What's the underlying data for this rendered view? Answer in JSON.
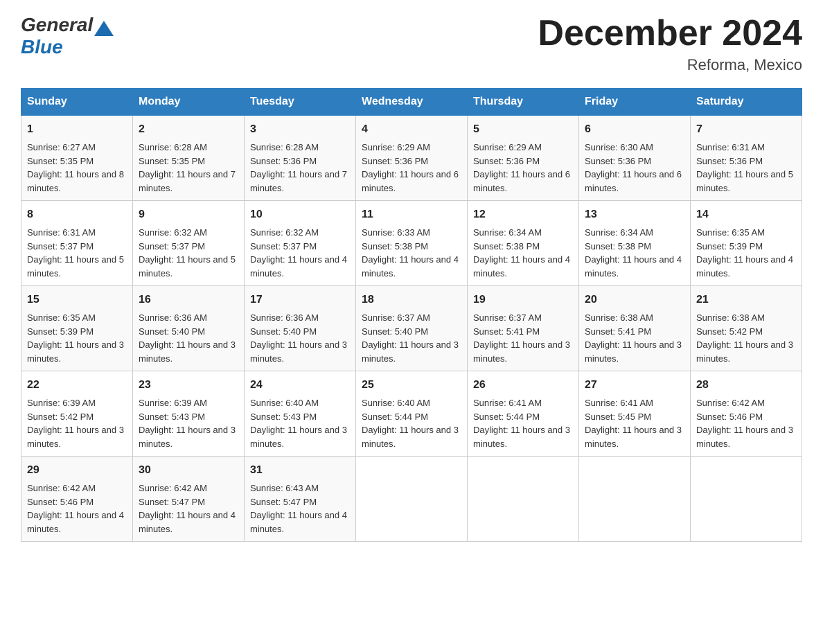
{
  "header": {
    "logo_general": "General",
    "logo_blue": "Blue",
    "month_title": "December 2024",
    "location": "Reforma, Mexico"
  },
  "days_of_week": [
    "Sunday",
    "Monday",
    "Tuesday",
    "Wednesday",
    "Thursday",
    "Friday",
    "Saturday"
  ],
  "weeks": [
    [
      {
        "day": "1",
        "sunrise": "6:27 AM",
        "sunset": "5:35 PM",
        "daylight": "11 hours and 8 minutes."
      },
      {
        "day": "2",
        "sunrise": "6:28 AM",
        "sunset": "5:35 PM",
        "daylight": "11 hours and 7 minutes."
      },
      {
        "day": "3",
        "sunrise": "6:28 AM",
        "sunset": "5:36 PM",
        "daylight": "11 hours and 7 minutes."
      },
      {
        "day": "4",
        "sunrise": "6:29 AM",
        "sunset": "5:36 PM",
        "daylight": "11 hours and 6 minutes."
      },
      {
        "day": "5",
        "sunrise": "6:29 AM",
        "sunset": "5:36 PM",
        "daylight": "11 hours and 6 minutes."
      },
      {
        "day": "6",
        "sunrise": "6:30 AM",
        "sunset": "5:36 PM",
        "daylight": "11 hours and 6 minutes."
      },
      {
        "day": "7",
        "sunrise": "6:31 AM",
        "sunset": "5:36 PM",
        "daylight": "11 hours and 5 minutes."
      }
    ],
    [
      {
        "day": "8",
        "sunrise": "6:31 AM",
        "sunset": "5:37 PM",
        "daylight": "11 hours and 5 minutes."
      },
      {
        "day": "9",
        "sunrise": "6:32 AM",
        "sunset": "5:37 PM",
        "daylight": "11 hours and 5 minutes."
      },
      {
        "day": "10",
        "sunrise": "6:32 AM",
        "sunset": "5:37 PM",
        "daylight": "11 hours and 4 minutes."
      },
      {
        "day": "11",
        "sunrise": "6:33 AM",
        "sunset": "5:38 PM",
        "daylight": "11 hours and 4 minutes."
      },
      {
        "day": "12",
        "sunrise": "6:34 AM",
        "sunset": "5:38 PM",
        "daylight": "11 hours and 4 minutes."
      },
      {
        "day": "13",
        "sunrise": "6:34 AM",
        "sunset": "5:38 PM",
        "daylight": "11 hours and 4 minutes."
      },
      {
        "day": "14",
        "sunrise": "6:35 AM",
        "sunset": "5:39 PM",
        "daylight": "11 hours and 4 minutes."
      }
    ],
    [
      {
        "day": "15",
        "sunrise": "6:35 AM",
        "sunset": "5:39 PM",
        "daylight": "11 hours and 3 minutes."
      },
      {
        "day": "16",
        "sunrise": "6:36 AM",
        "sunset": "5:40 PM",
        "daylight": "11 hours and 3 minutes."
      },
      {
        "day": "17",
        "sunrise": "6:36 AM",
        "sunset": "5:40 PM",
        "daylight": "11 hours and 3 minutes."
      },
      {
        "day": "18",
        "sunrise": "6:37 AM",
        "sunset": "5:40 PM",
        "daylight": "11 hours and 3 minutes."
      },
      {
        "day": "19",
        "sunrise": "6:37 AM",
        "sunset": "5:41 PM",
        "daylight": "11 hours and 3 minutes."
      },
      {
        "day": "20",
        "sunrise": "6:38 AM",
        "sunset": "5:41 PM",
        "daylight": "11 hours and 3 minutes."
      },
      {
        "day": "21",
        "sunrise": "6:38 AM",
        "sunset": "5:42 PM",
        "daylight": "11 hours and 3 minutes."
      }
    ],
    [
      {
        "day": "22",
        "sunrise": "6:39 AM",
        "sunset": "5:42 PM",
        "daylight": "11 hours and 3 minutes."
      },
      {
        "day": "23",
        "sunrise": "6:39 AM",
        "sunset": "5:43 PM",
        "daylight": "11 hours and 3 minutes."
      },
      {
        "day": "24",
        "sunrise": "6:40 AM",
        "sunset": "5:43 PM",
        "daylight": "11 hours and 3 minutes."
      },
      {
        "day": "25",
        "sunrise": "6:40 AM",
        "sunset": "5:44 PM",
        "daylight": "11 hours and 3 minutes."
      },
      {
        "day": "26",
        "sunrise": "6:41 AM",
        "sunset": "5:44 PM",
        "daylight": "11 hours and 3 minutes."
      },
      {
        "day": "27",
        "sunrise": "6:41 AM",
        "sunset": "5:45 PM",
        "daylight": "11 hours and 3 minutes."
      },
      {
        "day": "28",
        "sunrise": "6:42 AM",
        "sunset": "5:46 PM",
        "daylight": "11 hours and 3 minutes."
      }
    ],
    [
      {
        "day": "29",
        "sunrise": "6:42 AM",
        "sunset": "5:46 PM",
        "daylight": "11 hours and 4 minutes."
      },
      {
        "day": "30",
        "sunrise": "6:42 AM",
        "sunset": "5:47 PM",
        "daylight": "11 hours and 4 minutes."
      },
      {
        "day": "31",
        "sunrise": "6:43 AM",
        "sunset": "5:47 PM",
        "daylight": "11 hours and 4 minutes."
      },
      null,
      null,
      null,
      null
    ]
  ],
  "labels": {
    "sunrise": "Sunrise:",
    "sunset": "Sunset:",
    "daylight": "Daylight:"
  }
}
